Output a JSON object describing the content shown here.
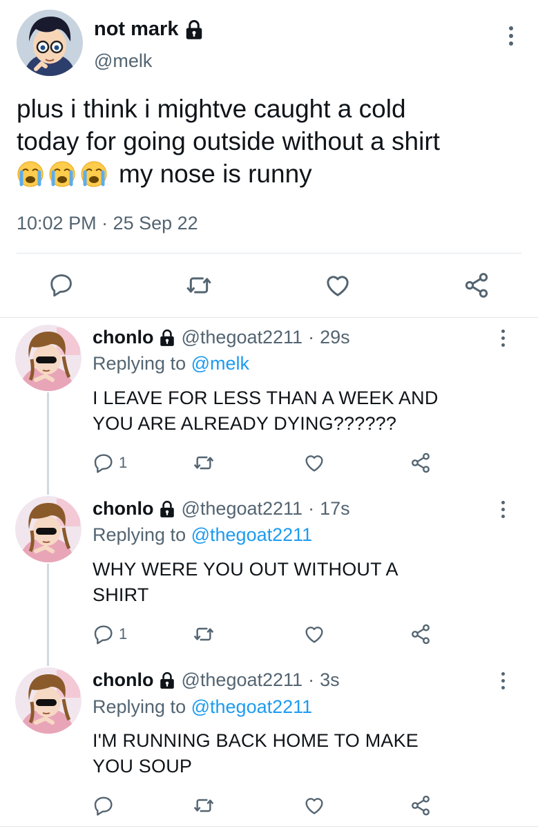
{
  "main_tweet": {
    "author_name": "not mark",
    "author_handle": "@melk",
    "text_lines": [
      "plus i think i mightve caught a cold",
      "today for going outside without a shirt"
    ],
    "text_tail": "my nose is runny",
    "emoji": [
      "loudly-crying-face",
      "loudly-crying-face",
      "loudly-crying-face"
    ],
    "timestamp": "10:02 PM · 25 Sep 22",
    "actions": [
      "reply-icon",
      "retweet-icon",
      "like-icon",
      "share-icon"
    ]
  },
  "replies": [
    {
      "author_name": "chonlo",
      "author_handle": "@thegoat2211",
      "separator": "·",
      "time": "29s",
      "replying_prefix": "Replying to",
      "replying_to": "@melk",
      "text_lines": [
        "I LEAVE FOR LESS THAN A WEEK AND",
        "YOU ARE ALREADY DYING??????"
      ],
      "reply_count": "1"
    },
    {
      "author_name": "chonlo",
      "author_handle": "@thegoat2211",
      "separator": "·",
      "time": "17s",
      "replying_prefix": "Replying to",
      "replying_to": "@thegoat2211",
      "text_lines": [
        "WHY WERE YOU OUT WITHOUT A",
        "SHIRT"
      ],
      "reply_count": "1"
    },
    {
      "author_name": "chonlo",
      "author_handle": "@thegoat2211",
      "separator": "·",
      "time": "3s",
      "replying_prefix": "Replying to",
      "replying_to": "@thegoat2211",
      "text_lines": [
        "I'M RUNNING BACK HOME TO MAKE",
        "YOU SOUP"
      ],
      "reply_count": ""
    }
  ],
  "colors": {
    "text": "#0f1419",
    "secondary": "#536471",
    "link": "#1d9bf0",
    "divider": "#e1e6ea"
  }
}
